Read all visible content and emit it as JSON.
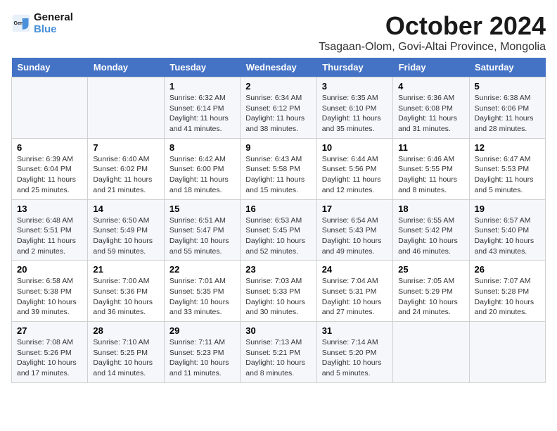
{
  "header": {
    "logo_line1": "General",
    "logo_line2": "Blue",
    "title": "October 2024",
    "subtitle": "Tsagaan-Olom, Govi-Altai Province, Mongolia"
  },
  "days_of_week": [
    "Sunday",
    "Monday",
    "Tuesday",
    "Wednesday",
    "Thursday",
    "Friday",
    "Saturday"
  ],
  "weeks": [
    [
      {
        "day": "",
        "sunrise": "",
        "sunset": "",
        "daylight": ""
      },
      {
        "day": "",
        "sunrise": "",
        "sunset": "",
        "daylight": ""
      },
      {
        "day": "1",
        "sunrise": "Sunrise: 6:32 AM",
        "sunset": "Sunset: 6:14 PM",
        "daylight": "Daylight: 11 hours and 41 minutes."
      },
      {
        "day": "2",
        "sunrise": "Sunrise: 6:34 AM",
        "sunset": "Sunset: 6:12 PM",
        "daylight": "Daylight: 11 hours and 38 minutes."
      },
      {
        "day": "3",
        "sunrise": "Sunrise: 6:35 AM",
        "sunset": "Sunset: 6:10 PM",
        "daylight": "Daylight: 11 hours and 35 minutes."
      },
      {
        "day": "4",
        "sunrise": "Sunrise: 6:36 AM",
        "sunset": "Sunset: 6:08 PM",
        "daylight": "Daylight: 11 hours and 31 minutes."
      },
      {
        "day": "5",
        "sunrise": "Sunrise: 6:38 AM",
        "sunset": "Sunset: 6:06 PM",
        "daylight": "Daylight: 11 hours and 28 minutes."
      }
    ],
    [
      {
        "day": "6",
        "sunrise": "Sunrise: 6:39 AM",
        "sunset": "Sunset: 6:04 PM",
        "daylight": "Daylight: 11 hours and 25 minutes."
      },
      {
        "day": "7",
        "sunrise": "Sunrise: 6:40 AM",
        "sunset": "Sunset: 6:02 PM",
        "daylight": "Daylight: 11 hours and 21 minutes."
      },
      {
        "day": "8",
        "sunrise": "Sunrise: 6:42 AM",
        "sunset": "Sunset: 6:00 PM",
        "daylight": "Daylight: 11 hours and 18 minutes."
      },
      {
        "day": "9",
        "sunrise": "Sunrise: 6:43 AM",
        "sunset": "Sunset: 5:58 PM",
        "daylight": "Daylight: 11 hours and 15 minutes."
      },
      {
        "day": "10",
        "sunrise": "Sunrise: 6:44 AM",
        "sunset": "Sunset: 5:56 PM",
        "daylight": "Daylight: 11 hours and 12 minutes."
      },
      {
        "day": "11",
        "sunrise": "Sunrise: 6:46 AM",
        "sunset": "Sunset: 5:55 PM",
        "daylight": "Daylight: 11 hours and 8 minutes."
      },
      {
        "day": "12",
        "sunrise": "Sunrise: 6:47 AM",
        "sunset": "Sunset: 5:53 PM",
        "daylight": "Daylight: 11 hours and 5 minutes."
      }
    ],
    [
      {
        "day": "13",
        "sunrise": "Sunrise: 6:48 AM",
        "sunset": "Sunset: 5:51 PM",
        "daylight": "Daylight: 11 hours and 2 minutes."
      },
      {
        "day": "14",
        "sunrise": "Sunrise: 6:50 AM",
        "sunset": "Sunset: 5:49 PM",
        "daylight": "Daylight: 10 hours and 59 minutes."
      },
      {
        "day": "15",
        "sunrise": "Sunrise: 6:51 AM",
        "sunset": "Sunset: 5:47 PM",
        "daylight": "Daylight: 10 hours and 55 minutes."
      },
      {
        "day": "16",
        "sunrise": "Sunrise: 6:53 AM",
        "sunset": "Sunset: 5:45 PM",
        "daylight": "Daylight: 10 hours and 52 minutes."
      },
      {
        "day": "17",
        "sunrise": "Sunrise: 6:54 AM",
        "sunset": "Sunset: 5:43 PM",
        "daylight": "Daylight: 10 hours and 49 minutes."
      },
      {
        "day": "18",
        "sunrise": "Sunrise: 6:55 AM",
        "sunset": "Sunset: 5:42 PM",
        "daylight": "Daylight: 10 hours and 46 minutes."
      },
      {
        "day": "19",
        "sunrise": "Sunrise: 6:57 AM",
        "sunset": "Sunset: 5:40 PM",
        "daylight": "Daylight: 10 hours and 43 minutes."
      }
    ],
    [
      {
        "day": "20",
        "sunrise": "Sunrise: 6:58 AM",
        "sunset": "Sunset: 5:38 PM",
        "daylight": "Daylight: 10 hours and 39 minutes."
      },
      {
        "day": "21",
        "sunrise": "Sunrise: 7:00 AM",
        "sunset": "Sunset: 5:36 PM",
        "daylight": "Daylight: 10 hours and 36 minutes."
      },
      {
        "day": "22",
        "sunrise": "Sunrise: 7:01 AM",
        "sunset": "Sunset: 5:35 PM",
        "daylight": "Daylight: 10 hours and 33 minutes."
      },
      {
        "day": "23",
        "sunrise": "Sunrise: 7:03 AM",
        "sunset": "Sunset: 5:33 PM",
        "daylight": "Daylight: 10 hours and 30 minutes."
      },
      {
        "day": "24",
        "sunrise": "Sunrise: 7:04 AM",
        "sunset": "Sunset: 5:31 PM",
        "daylight": "Daylight: 10 hours and 27 minutes."
      },
      {
        "day": "25",
        "sunrise": "Sunrise: 7:05 AM",
        "sunset": "Sunset: 5:29 PM",
        "daylight": "Daylight: 10 hours and 24 minutes."
      },
      {
        "day": "26",
        "sunrise": "Sunrise: 7:07 AM",
        "sunset": "Sunset: 5:28 PM",
        "daylight": "Daylight: 10 hours and 20 minutes."
      }
    ],
    [
      {
        "day": "27",
        "sunrise": "Sunrise: 7:08 AM",
        "sunset": "Sunset: 5:26 PM",
        "daylight": "Daylight: 10 hours and 17 minutes."
      },
      {
        "day": "28",
        "sunrise": "Sunrise: 7:10 AM",
        "sunset": "Sunset: 5:25 PM",
        "daylight": "Daylight: 10 hours and 14 minutes."
      },
      {
        "day": "29",
        "sunrise": "Sunrise: 7:11 AM",
        "sunset": "Sunset: 5:23 PM",
        "daylight": "Daylight: 10 hours and 11 minutes."
      },
      {
        "day": "30",
        "sunrise": "Sunrise: 7:13 AM",
        "sunset": "Sunset: 5:21 PM",
        "daylight": "Daylight: 10 hours and 8 minutes."
      },
      {
        "day": "31",
        "sunrise": "Sunrise: 7:14 AM",
        "sunset": "Sunset: 5:20 PM",
        "daylight": "Daylight: 10 hours and 5 minutes."
      },
      {
        "day": "",
        "sunrise": "",
        "sunset": "",
        "daylight": ""
      },
      {
        "day": "",
        "sunrise": "",
        "sunset": "",
        "daylight": ""
      }
    ]
  ]
}
